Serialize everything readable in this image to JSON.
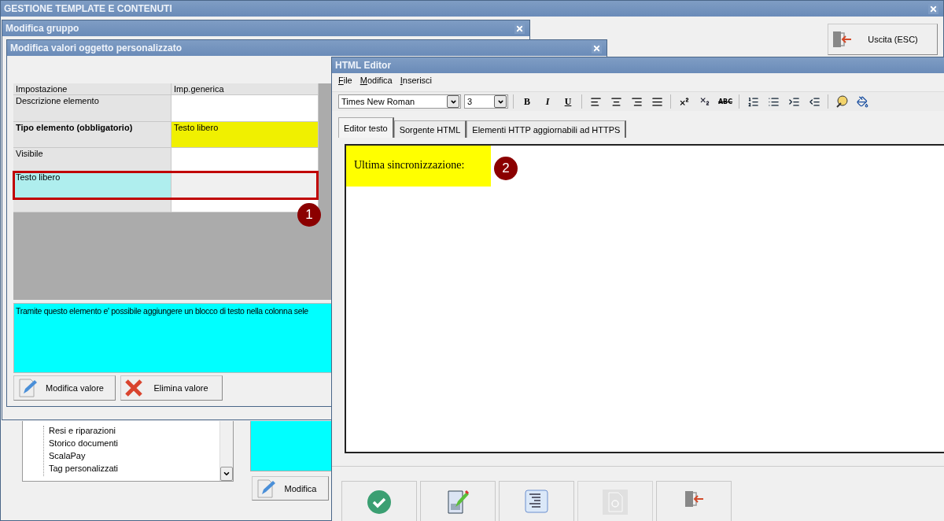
{
  "main_window": {
    "title": "GESTIONE TEMPLATE E CONTENUTI",
    "exit_button": "Uscita (ESC)"
  },
  "background_panel": {
    "tree_items": [
      "Resi e riparazioni",
      "Storico documenti",
      "ScalaPay",
      "Tag personalizzati"
    ],
    "edit_button": "Modifica"
  },
  "group_window": {
    "title": "Modifica gruppo"
  },
  "object_window": {
    "title": "Modifica valori oggetto personalizzato",
    "columns": [
      "Impostazione",
      "Imp.generica"
    ],
    "rows": [
      {
        "setting": "Descrizione elemento",
        "required": false,
        "selected": false
      },
      {
        "setting": "Tipo elemento (obbligatorio)",
        "value": "Testo libero",
        "required": true,
        "selected": false
      },
      {
        "setting": "Visibile",
        "required": false,
        "selected": false
      },
      {
        "setting": "Testo libero",
        "required": false,
        "selected": true
      }
    ],
    "description": "Tramite questo elemento e' possibile aggiungere un blocco di testo nella colonna sele",
    "buttons": [
      {
        "kind": "edit",
        "label": "Modifica valore"
      },
      {
        "kind": "delete",
        "label": "Elimina valore"
      }
    ]
  },
  "callouts": [
    "1",
    "2"
  ],
  "html_editor": {
    "title": "HTML Editor",
    "menu": [
      "File",
      "Modifica",
      "Inserisci"
    ],
    "font": "Times New Roman",
    "size": "3",
    "format_buttons": [
      "B",
      "I",
      "U"
    ],
    "spell_button": "ABC",
    "tabs": [
      {
        "label": "Editor testo",
        "selected": true
      },
      {
        "label": "Sorgente HTML",
        "selected": false
      },
      {
        "label": "Elementi HTTP aggiornabili ad HTTPS",
        "selected": false
      }
    ],
    "content": "Ultima sincronizzazione:",
    "actions": [
      {
        "kind": "confirm",
        "disabled": false
      },
      {
        "kind": "edit",
        "disabled": false
      },
      {
        "kind": "outline",
        "disabled": false
      },
      {
        "kind": "component",
        "disabled": true
      },
      {
        "kind": "exit",
        "disabled": false
      }
    ]
  }
}
